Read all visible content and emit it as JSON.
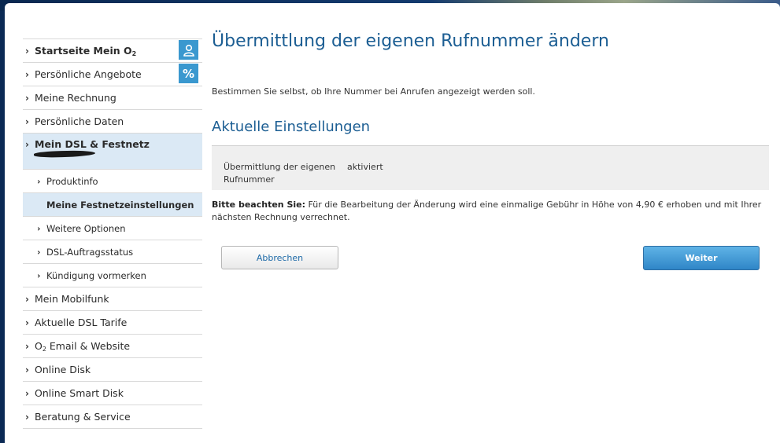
{
  "sidebar": {
    "items": [
      {
        "label": "Startseite Mein O",
        "sub": "2"
      },
      {
        "label": "Persönliche Angebote"
      },
      {
        "label": "Meine Rechnung"
      },
      {
        "label": "Persönliche Daten"
      },
      {
        "label": "Mein DSL & Festnetz"
      },
      {
        "label": "Produktinfo"
      },
      {
        "label": "Meine Festnetzeinstellungen"
      },
      {
        "label": "Weitere Optionen"
      },
      {
        "label": "DSL-Auftragsstatus"
      },
      {
        "label": "Kündigung vormerken"
      },
      {
        "label": "Mein Mobilfunk"
      },
      {
        "label": "Aktuelle DSL Tarife"
      },
      {
        "label_prefix": "O",
        "sub": "2",
        "label": " Email & Website"
      },
      {
        "label": "Online Disk"
      },
      {
        "label": "Online Smart Disk"
      },
      {
        "label": "Beratung & Service"
      }
    ],
    "badges": {
      "percent": "%"
    }
  },
  "main": {
    "title": "Übermittlung der eigenen Rufnummer ändern",
    "intro": "Bestimmen Sie selbst, ob Ihre Nummer bei Anrufen angezeigt werden soll.",
    "section_title": "Aktuelle Einstellungen",
    "setting_label": "Übermittlung der eigenen Rufnummer",
    "setting_value": "aktiviert",
    "note_bold": "Bitte beachten Sie:",
    "note_text": " Für die Bearbeitung der Änderung wird eine einmalige Gebühr in Höhe von 4,90 € erhoben und mit Ihrer nächsten Rechnung verrechnet.",
    "cancel_label": "Abbrechen",
    "next_label": "Weiter"
  },
  "colors": {
    "accent": "#1c5e93",
    "badge": "#3a98cf",
    "active_bg": "#dbe9f5"
  },
  "icons": {
    "badge_user": "user-icon",
    "badge_percent": "percent-icon",
    "chevron": "chevron-right-icon"
  }
}
